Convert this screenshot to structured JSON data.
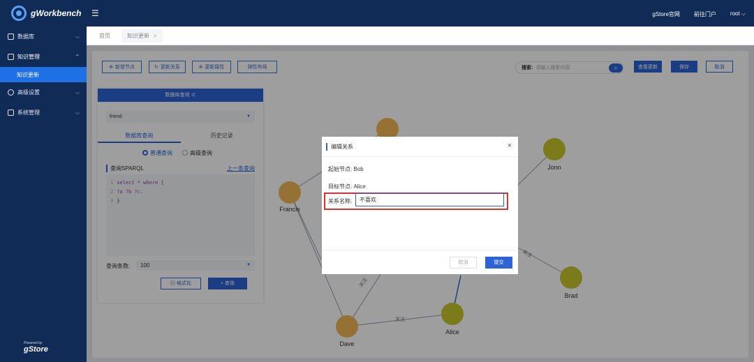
{
  "app": {
    "title": "gWorkbench"
  },
  "sidebar": {
    "items": [
      {
        "label": "数据库"
      },
      {
        "label": "知识管理"
      },
      {
        "label": "知识更新"
      },
      {
        "label": "高级设置"
      },
      {
        "label": "系统管理"
      }
    ],
    "powered_by": "Powered by",
    "brand": "gStore"
  },
  "topbar": {
    "links": [
      "gStore官网",
      "前往门户",
      "root ⌵"
    ]
  },
  "tabs": [
    {
      "label": "首页"
    },
    {
      "label": "知识更新"
    }
  ],
  "toolbar": {
    "add_node": "新增节点",
    "update_relation": "更新关系",
    "update_attr": "更新属性",
    "elastic_layout": "弹性布局",
    "search_label": "搜索:",
    "search_placeholder": "请输入搜索内容",
    "view_update": "查看更新",
    "save": "保存",
    "cancel": "取消"
  },
  "db_panel": {
    "header": "数据库查询 ≪",
    "database": "friend",
    "tab_query": "数据库查询",
    "tab_history": "历史记录",
    "mode_normal": "普通查询",
    "mode_advanced": "高级查询",
    "sparql_label": "查询SPARQL",
    "prev_query": "上一条查询",
    "code_lines": [
      "select * where {",
      "?a ?b ?c.",
      "}"
    ],
    "limit_label": "查询条数:",
    "limit_value": "100",
    "format_btn": "格式化",
    "query_btn": "查询"
  },
  "graph": {
    "nodes": [
      "Francis",
      "Jonn",
      "Brad",
      "Alice",
      "Dave"
    ],
    "edge_label": "关注"
  },
  "dialog": {
    "title": "编辑关系",
    "source_label": "起始节点:",
    "source_value": "Bob",
    "target_label": "目标节点:",
    "target_value": "Alice",
    "relation_label": "关系名称:",
    "relation_value": "不喜欢",
    "cancel": "取消",
    "submit": "提交"
  }
}
